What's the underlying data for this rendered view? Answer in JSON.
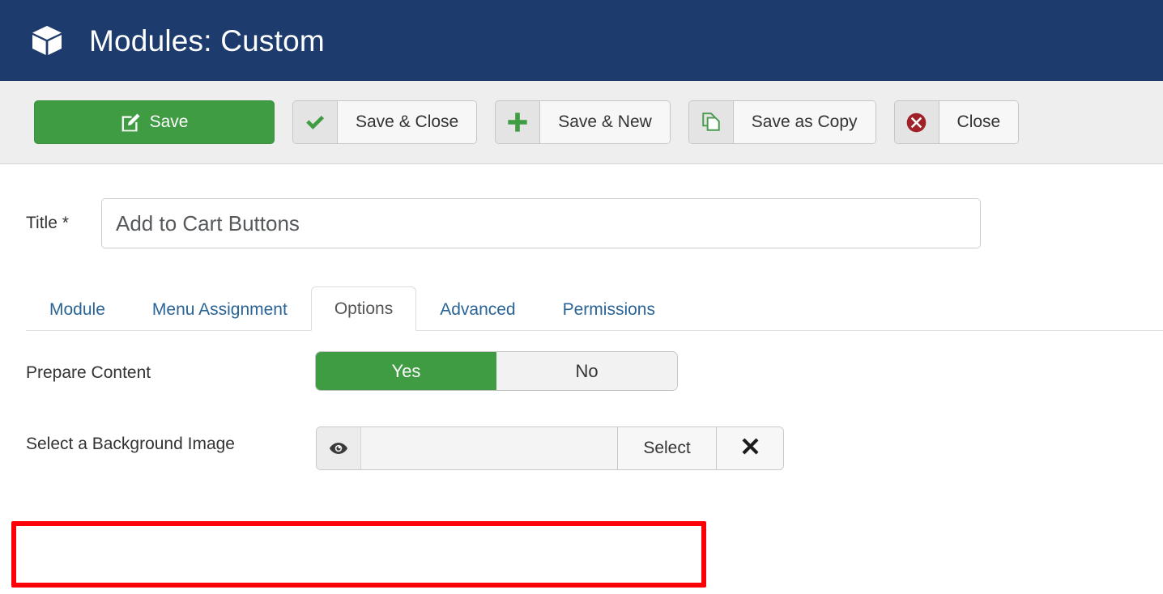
{
  "header": {
    "icon": "cube-icon",
    "title": "Modules: Custom",
    "bg_color": "#1d3c6d"
  },
  "toolbar": {
    "buttons": [
      {
        "label": "Save",
        "icon": "edit-pencil-square-icon",
        "style": "primary",
        "color": "#3f9c43"
      },
      {
        "label": "Save & Close",
        "icon": "check-icon",
        "style": "split"
      },
      {
        "label": "Save & New",
        "icon": "plus-icon",
        "style": "split"
      },
      {
        "label": "Save as Copy",
        "icon": "copy-documents-icon",
        "style": "split"
      },
      {
        "label": "Close",
        "icon": "close-circle-icon",
        "style": "split"
      }
    ]
  },
  "form": {
    "title_label": "Title *",
    "title_value": "Add to Cart Buttons",
    "title_placeholder": ""
  },
  "tabs": [
    {
      "label": "Module",
      "active": false
    },
    {
      "label": "Menu Assignment",
      "active": false
    },
    {
      "label": "Options",
      "active": true
    },
    {
      "label": "Advanced",
      "active": false
    },
    {
      "label": "Permissions",
      "active": false
    }
  ],
  "fields": {
    "prepare_content": {
      "label": "Prepare Content",
      "options": [
        {
          "label": "Yes",
          "selected": true
        },
        {
          "label": "No",
          "selected": false
        }
      ],
      "highlight_color": "#fb0007"
    },
    "background_image": {
      "label": "Select a Background Image",
      "value": "",
      "placeholder": "",
      "preview_icon": "eye-icon",
      "select_label": "Select",
      "clear_icon": "x-icon"
    }
  }
}
